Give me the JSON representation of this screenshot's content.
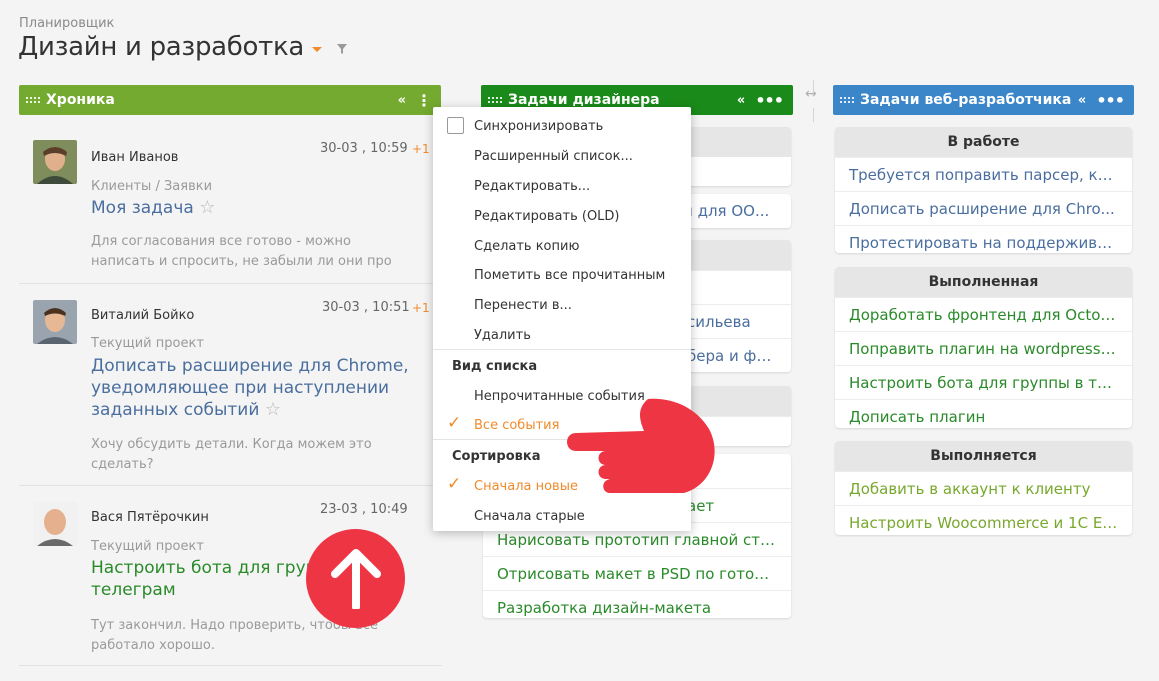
{
  "breadcrumb": "Планировщик",
  "page_title": "Дизайн и разработка",
  "columns": [
    {
      "title": "Хроника",
      "color": "#74aa2f"
    },
    {
      "title": "Задачи дизайнера",
      "color": "#1a8a1a"
    },
    {
      "title": "Задачи веб-разработчика",
      "color": "#3a86c8"
    }
  ],
  "header_icons": {
    "collapse": "«",
    "more": "•••",
    "more_vertical": "⋮"
  },
  "feed": [
    {
      "author": "Иван Иванов",
      "date": "30-03 , 10:59",
      "badge": "+1",
      "project": "Клиенты / Заявки",
      "title": "Моя задача",
      "comment": [
        "Для согласования все готово - можно",
        "написать и спросить, не забыли ли они про"
      ]
    },
    {
      "author": "Виталий Бойко",
      "date": "30-03 , 10:51",
      "badge": "+1",
      "project": "Текущий проект",
      "title": [
        "Дописать расширение для Chrome,",
        "уведомляющее при наступлении",
        "заданных событий"
      ],
      "comment": [
        "Хочу обсудить детали. Когда можем это",
        "сделать?"
      ]
    },
    {
      "author": "Вася Пятёрочкин",
      "date": "23-03 , 10:49",
      "project": "Текущий проект",
      "title": [
        "Настроить бота для группы",
        "телеграм"
      ],
      "comment": [
        "Тут закончил. Надо проверить, чтобы все",
        "работало хорошо."
      ]
    }
  ],
  "designer_cards": {
    "partial_rows": [
      "н для ОО...",
      "сильева",
      "бера и фа...",
      "ает"
    ],
    "bottom_rows": [
      "Нарисовать прототип главной стр...",
      "Отрисовать макет в PSD по готово...",
      "Разработка дизайн-макета"
    ]
  },
  "dev_cards": [
    {
      "title": "В работе",
      "color": "#4a6e9e",
      "rows": [
        "Требуется поправить парсер, ко...",
        "Дописать расширение для Chro...",
        "Протестировать на поддержива..."
      ]
    },
    {
      "title": "Выполненная",
      "color": "#2a8a2a",
      "rows": [
        "Доработать фронтенд для Octob...",
        "Поправить плагин на wordpress ...",
        "Настроить бота для группы в телег...",
        "Дописать плагин"
      ]
    },
    {
      "title": "Выполняется",
      "color": "#78a82e",
      "rows": [
        "Добавить в аккаунт к клиенту",
        "Настроить Woocommerce и 1С En..."
      ]
    }
  ],
  "menu": {
    "items": [
      "Синхронизировать",
      "Расширенный список...",
      "Редактировать...",
      "Редактировать (OLD)",
      "Сделать копию",
      "Пометить все прочитанным",
      "Перенести в...",
      "Удалить"
    ],
    "view_header": "Вид списка",
    "view_options": [
      "Непрочитанные события",
      "Все события"
    ],
    "sort_header": "Сортировка",
    "sort_options": [
      "Сначала новые",
      "Сначала старые"
    ],
    "selected_view": "Все события",
    "selected_sort": "Сначала новые"
  },
  "icons": {
    "filter": "filter-icon",
    "star": "star-icon",
    "hand": "pointing-hand-icon",
    "up": "arrow-up-icon"
  },
  "accent": "#f08b2c"
}
